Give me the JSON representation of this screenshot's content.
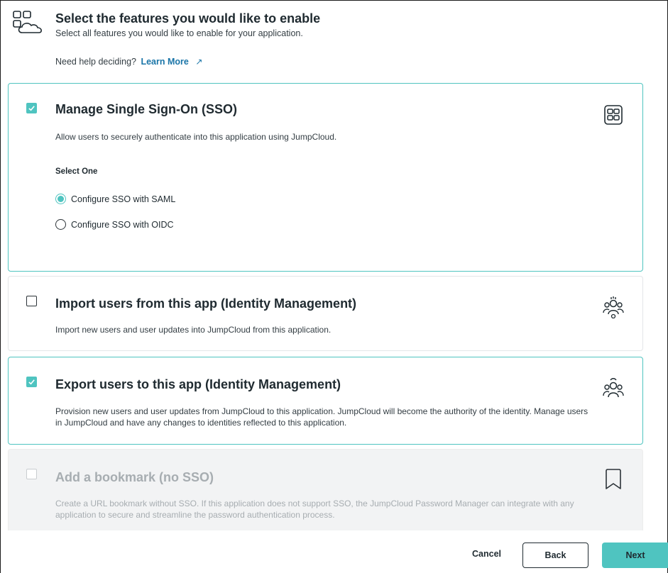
{
  "header": {
    "title": "Select the features you would like to enable",
    "subtitle": "Select all features you would like to enable for your application.",
    "help_text": "Need help deciding?",
    "help_link": "Learn More",
    "help_link_icon": "↗",
    "icon": "apps-cloud-icon"
  },
  "features": [
    {
      "title": "Manage Single Sign-On (SSO)",
      "description": "Allow users to securely authenticate into this application using JumpCloud.",
      "checked": true,
      "icon": "grid-apps-icon",
      "select_label": "Select One",
      "options": [
        {
          "label": "Configure SSO with SAML",
          "selected": true
        },
        {
          "label": "Configure SSO with OIDC",
          "selected": false
        }
      ]
    },
    {
      "title": "Import users from this app (Identity Management)",
      "description": "Import new users and user updates into JumpCloud from this application.",
      "checked": false,
      "icon": "users-import-icon"
    },
    {
      "title": "Export users to this app (Identity Management)",
      "description": "Provision new users and user updates from JumpCloud to this application. JumpCloud will become the authority of the identity. Manage users in JumpCloud and have any changes to identities reflected to this application.",
      "checked": true,
      "icon": "users-export-icon"
    },
    {
      "title": "Add a bookmark (no SSO)",
      "description": "Create a URL bookmark without SSO. If this application does not support SSO, the JumpCloud Password Manager can integrate with any application to secure and streamline the password authentication process.",
      "checked": false,
      "disabled": true,
      "icon": "bookmark-icon"
    }
  ],
  "footer": {
    "cancel_label": "Cancel",
    "back_label": "Back",
    "next_label": "Next"
  },
  "colors": {
    "accent": "#4fc4c0",
    "link": "#1a75a8",
    "text": "#1f2a30",
    "disabled_text": "#a7adb1"
  }
}
